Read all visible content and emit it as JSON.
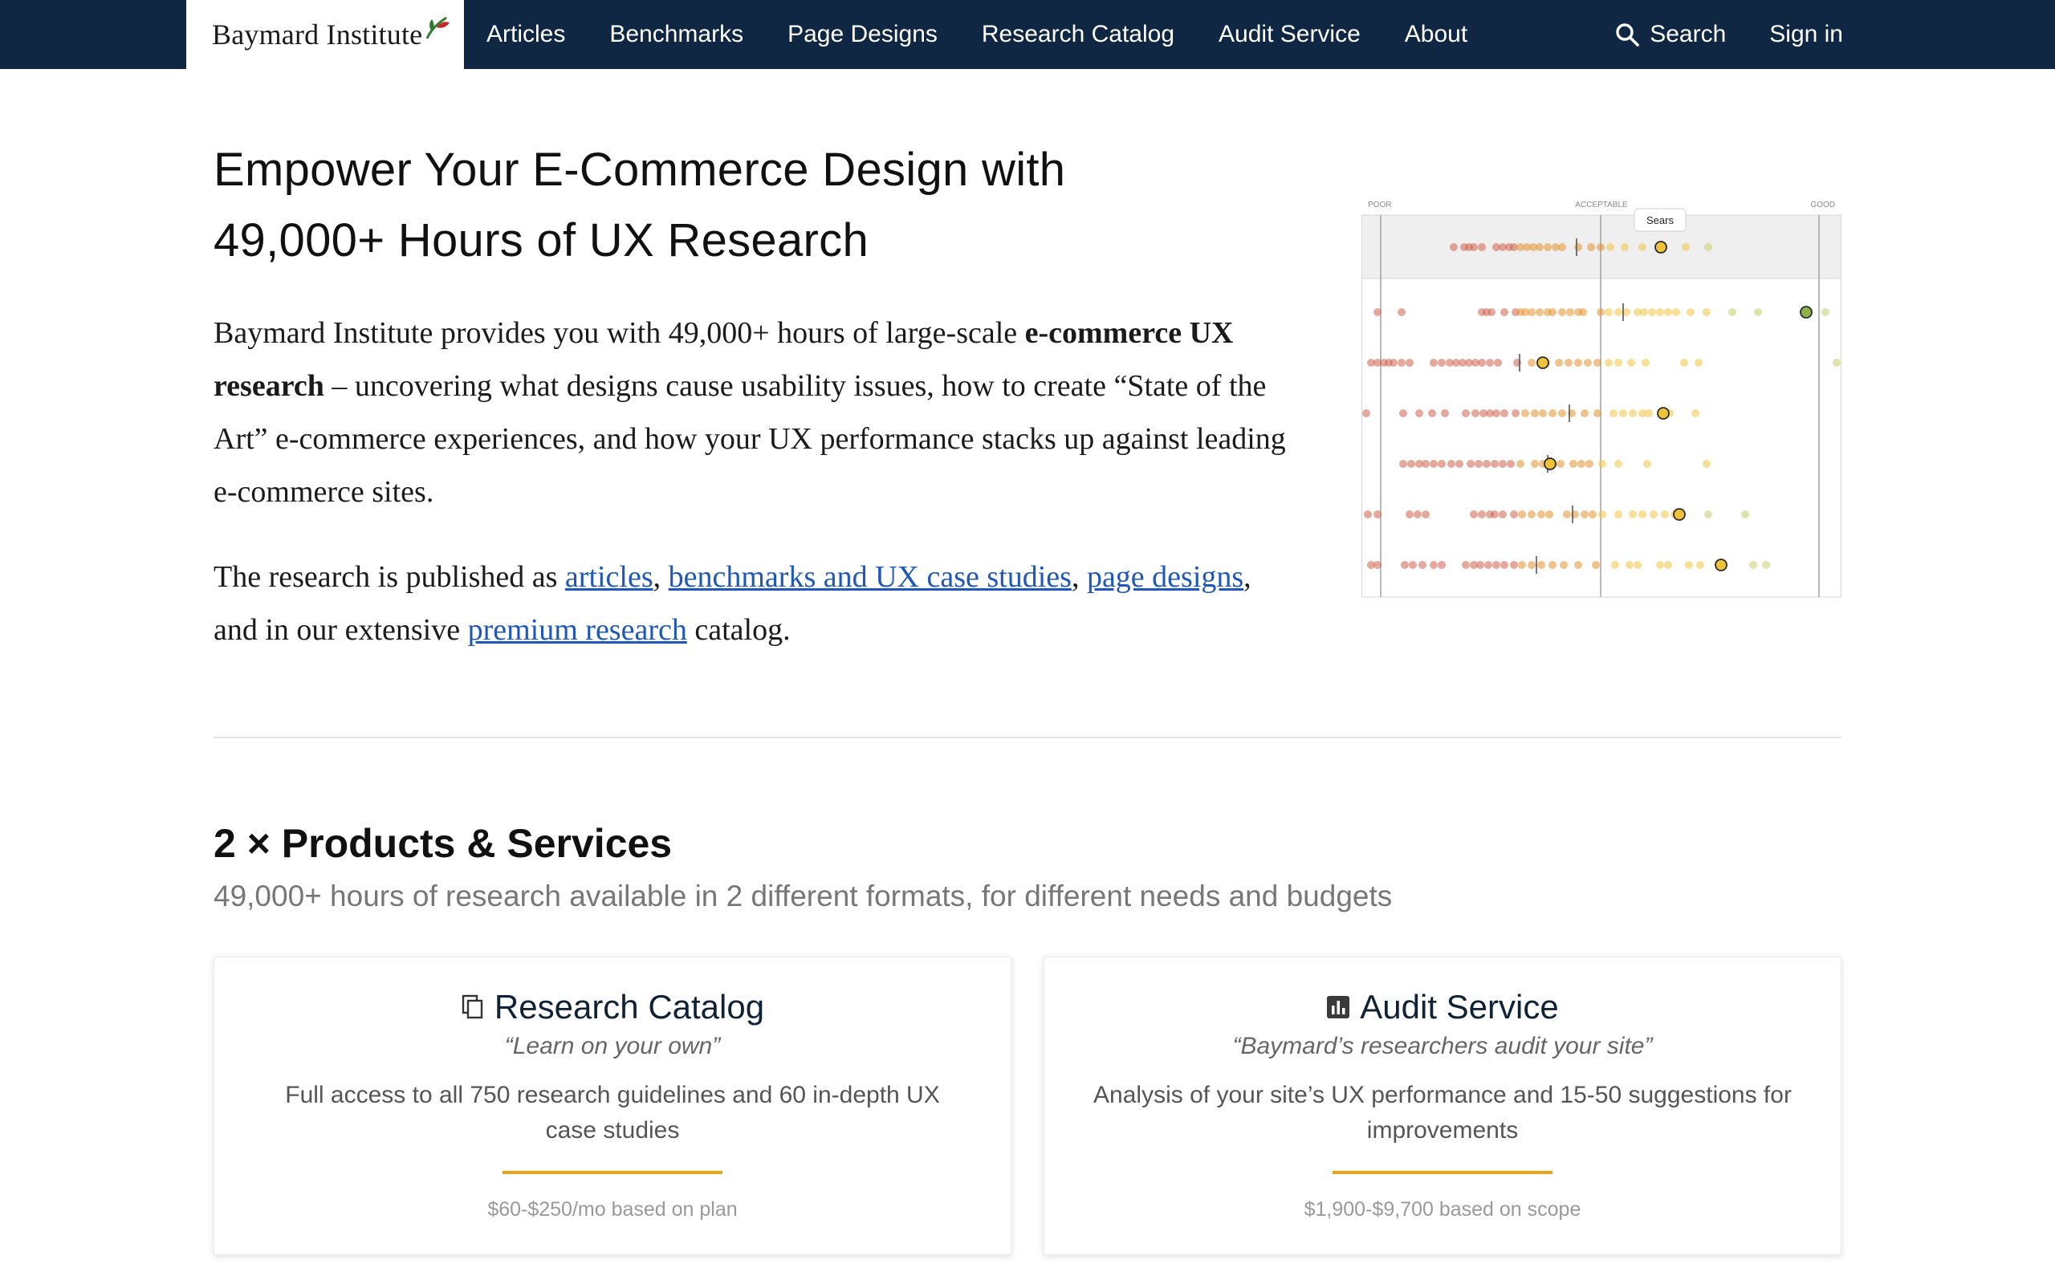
{
  "nav": {
    "logo_text": "Baymard Institute",
    "items": [
      "Articles",
      "Benchmarks",
      "Page Designs",
      "Research Catalog",
      "Audit Service",
      "About"
    ],
    "search_label": "Search",
    "signin_label": "Sign in",
    "bg_color": "#0f2742"
  },
  "hero": {
    "title_line1": "Empower Your E-Commerce Design with",
    "title_line2": "49,000+ Hours of UX Research",
    "p1_a": "Baymard Institute provides you with 49,000+ hours of large-scale ",
    "p1_bold": "e-commerce UX research",
    "p1_b": " – uncovering what designs cause usability issues, how to create “State of the Art” e-commerce experiences, and how your UX performance stacks up against leading e-commerce sites.",
    "p2_a": "The research is published as ",
    "link_articles": "articles",
    "p2_sep1": ", ",
    "link_benchmarks": "benchmarks and UX case studies",
    "p2_sep2": ", ",
    "link_pages": "page designs",
    "p2_b": ", and in our extensive ",
    "link_premium": "premium research",
    "p2_c": " catalog.",
    "link_color": "#1f58b8"
  },
  "benchmark_graphic": {
    "scale_labels": [
      "POOR",
      "ACCEPTABLE",
      "GOOD"
    ],
    "tooltip": "Sears"
  },
  "products": {
    "title": "2 × Products & Services",
    "subtitle": "49,000+ hours of research available in 2 different formats, for different needs and budgets",
    "cards": [
      {
        "icon": "copy-icon",
        "title": "Research Catalog",
        "tagline": "“Learn on your own”",
        "description": "Full access to all 750 research guidelines and 60 in-depth UX case studies",
        "price": "$60-$250/mo based on plan"
      },
      {
        "icon": "bar-chart-icon",
        "title": "Audit Service",
        "tagline": "“Baymard’s researchers audit your site”",
        "description": "Analysis of your site’s UX performance and 15-50 suggestions for improvements",
        "price": "$1,900-$9,700 based on scope"
      }
    ],
    "accent_color": "#e8a317"
  }
}
